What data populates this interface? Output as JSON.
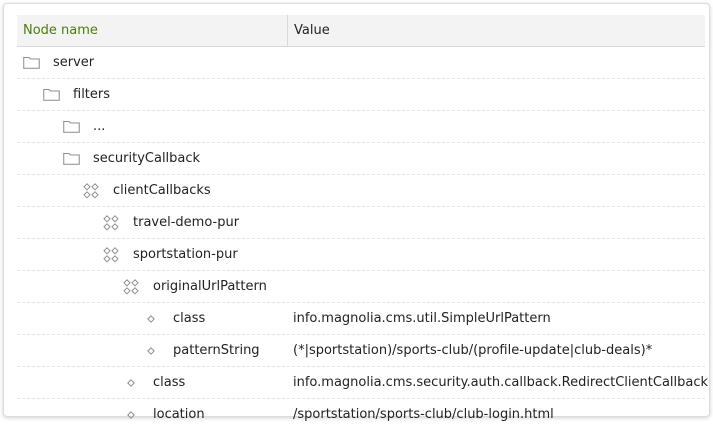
{
  "header": {
    "name_col": "Node name",
    "value_col": "Value"
  },
  "rows": [
    {
      "label": "server",
      "value": "",
      "icon": "folder-icon",
      "depth": 0
    },
    {
      "label": "filters",
      "value": "",
      "icon": "folder-icon",
      "depth": 1
    },
    {
      "label": "...",
      "value": "",
      "icon": "folder-icon",
      "depth": 2
    },
    {
      "label": "securityCallback",
      "value": "",
      "icon": "folder-icon",
      "depth": 2
    },
    {
      "label": "clientCallbacks",
      "value": "",
      "icon": "content-node-icon",
      "depth": 3
    },
    {
      "label": "travel-demo-pur",
      "value": "",
      "icon": "content-node-icon",
      "depth": 4
    },
    {
      "label": "sportstation-pur",
      "value": "",
      "icon": "content-node-icon",
      "depth": 4
    },
    {
      "label": "originalUrlPattern",
      "value": "",
      "icon": "content-node-icon",
      "depth": 5
    },
    {
      "label": "class",
      "value": "info.magnolia.cms.util.SimpleUrlPattern",
      "icon": "property-icon",
      "depth": 6
    },
    {
      "label": "patternString",
      "value": "(*|sportstation)/sports-club/(profile-update|club-deals)*",
      "icon": "property-icon",
      "depth": 6
    },
    {
      "label": "class",
      "value": "info.magnolia.cms.security.auth.callback.RedirectClientCallback",
      "icon": "property-icon",
      "depth": 5
    },
    {
      "label": "location",
      "value": "/sportstation/sports-club/club-login.html",
      "icon": "property-icon",
      "depth": 5
    }
  ]
}
